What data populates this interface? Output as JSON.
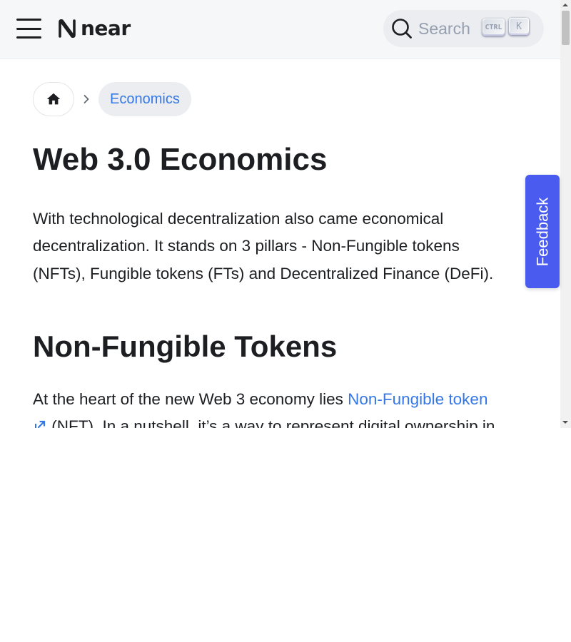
{
  "navbar": {
    "brand": "near",
    "search": {
      "label": "Search",
      "key_ctrl": "CTRL",
      "key_k": "K"
    }
  },
  "breadcrumb": {
    "current": "Economics"
  },
  "article": {
    "title": "Web 3.0 Economics",
    "intro_lines": [
      "With technological decentralization also came economical",
      "decentralization. It stands on 3 pillars - Non-Fungible tokens",
      "(NFTs), Fungible tokens (FTs) and Decentralized Finance (DeFi)."
    ],
    "section_title": "Non-Fungible Tokens",
    "nft_paragraph": {
      "prefix": "At the heart of the new Web 3 economy lies ",
      "link_text": "Non-Fungible token",
      "continuation": "(NFT). In a nutshell, it’s a way to represent digital ownership in"
    }
  },
  "feedback": {
    "label": "Feedback"
  },
  "colors": {
    "navbar_bg": "#f6f7f8",
    "link": "#3578e5",
    "feedback_bg": "#4a5cf0",
    "text": "#1c1e21"
  },
  "icons": [
    "menu-icon",
    "near-logo-icon",
    "search-icon",
    "home-icon",
    "chevron-right-icon",
    "external-link-icon"
  ]
}
